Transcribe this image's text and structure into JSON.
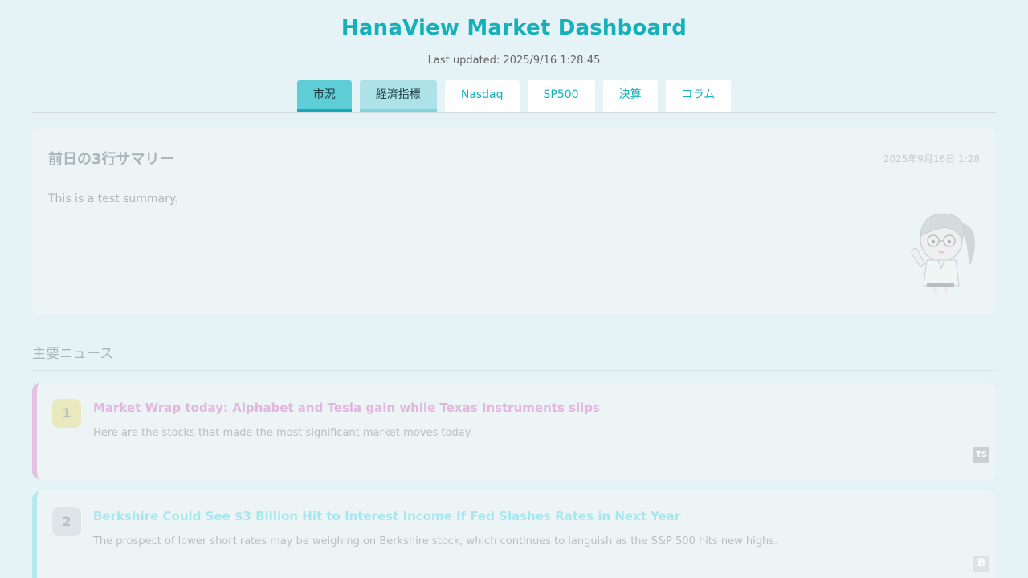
{
  "header": {
    "title": "HanaView Market Dashboard",
    "last_updated": "Last updated: 2025/9/16 1:28:45"
  },
  "tabs": [
    {
      "label": "市況",
      "state": "active"
    },
    {
      "label": "経済指標",
      "state": "secondary"
    },
    {
      "label": "Nasdaq",
      "state": "normal"
    },
    {
      "label": "SP500",
      "state": "normal"
    },
    {
      "label": "決算",
      "state": "normal"
    },
    {
      "label": "コラム",
      "state": "normal"
    }
  ],
  "summary": {
    "title": "前日の3行サマリー",
    "date": "2025年9月16日 1:28",
    "text": "This is a test summary.",
    "mascot_icon": "mascot-girl-illustration"
  },
  "news_section": {
    "title": "主要ニュース",
    "items": [
      {
        "rank": "1",
        "title": "Market Wrap today: Alphabet and Tesla gain while Texas Instruments slips",
        "description": "Here are the stocks that made the most significant market moves today.",
        "source_icon": "TS"
      },
      {
        "rank": "2",
        "title": "Berkshire Could See $3 Billion Hit to Interest Income If Fed Slashes Rates in Next Year",
        "description": "The prospect of lower short rates may be weighing on Berkshire stock, which continues to languish as the S&P 500 hits new highs.",
        "source_icon": "B"
      }
    ]
  },
  "colors": {
    "accent": "#14b1bb",
    "active_tab": "#5ecdd6",
    "news1_border": "#e3c1e1",
    "news2_border": "#b6e9ee",
    "background": "#e5f2f6"
  }
}
